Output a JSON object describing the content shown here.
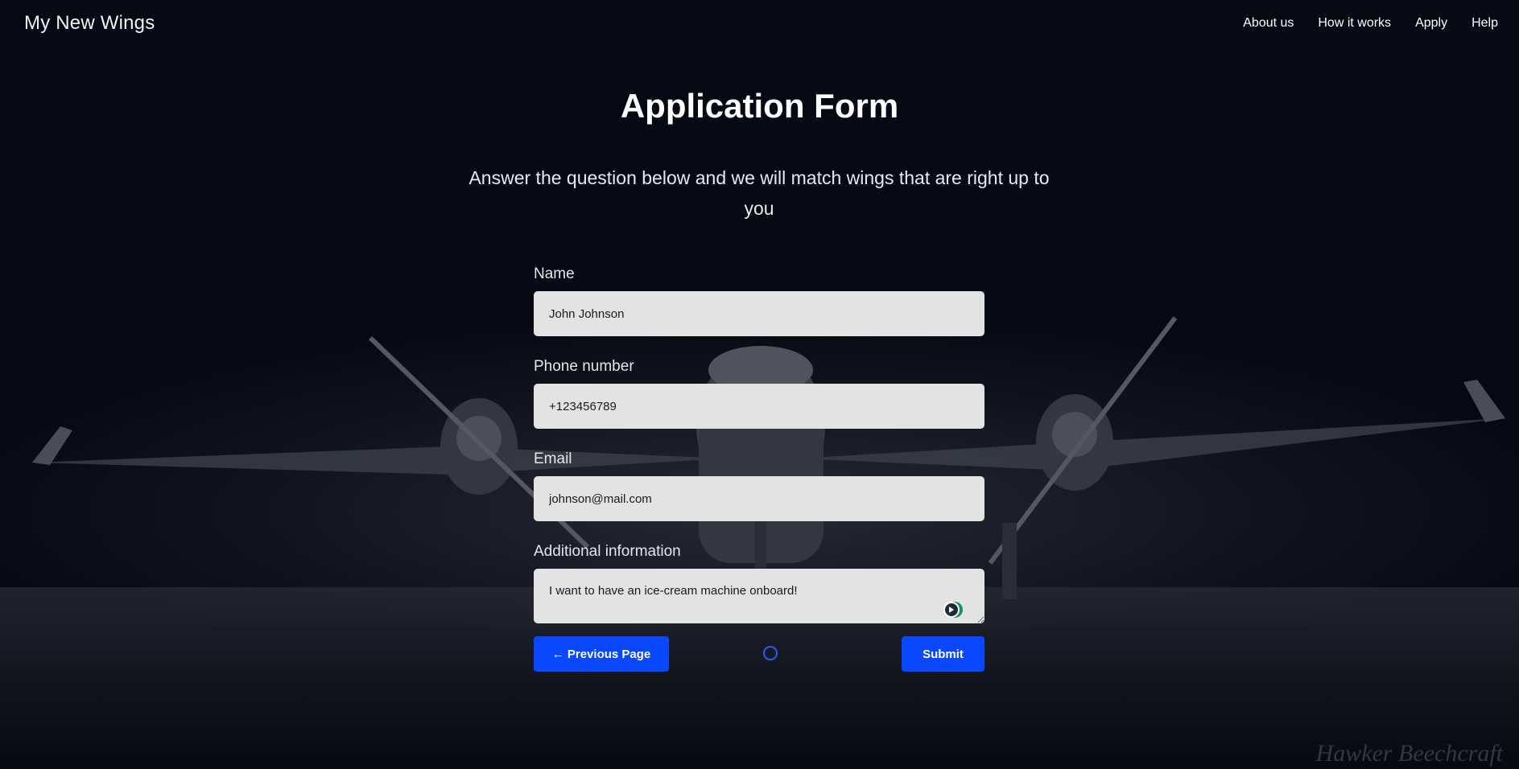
{
  "app": {
    "brand": "My New Wings"
  },
  "nav": {
    "items": [
      "About us",
      "How it works",
      "Apply",
      "Help"
    ]
  },
  "page": {
    "title": "Application Form",
    "subtitle": "Answer the question below and we will match wings that are right up to you"
  },
  "form": {
    "name": {
      "label": "Name",
      "value": "John Johnson"
    },
    "phone": {
      "label": "Phone number",
      "value": "+123456789"
    },
    "email": {
      "label": "Email",
      "value": "johnson@mail.com"
    },
    "additional": {
      "label": "Additional information",
      "value": "I want to have an ice-cream machine onboard!"
    }
  },
  "actions": {
    "previous_label": "← Previous Page",
    "submit_label": "Submit"
  },
  "watermark": "Hawker Beechcraft",
  "colors": {
    "background": "#060813",
    "button": "#0a48ff",
    "field": "#e3e3e3"
  }
}
